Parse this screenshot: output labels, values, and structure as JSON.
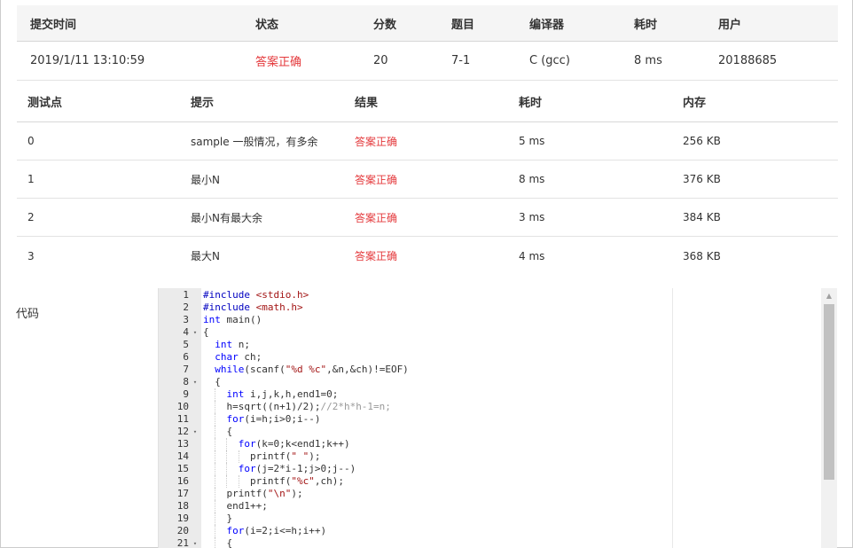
{
  "submission": {
    "headers": [
      "提交时间",
      "状态",
      "分数",
      "题目",
      "编译器",
      "耗时",
      "用户"
    ],
    "row": [
      "2019/1/11 13:10:59",
      "答案正确",
      "20",
      "7-1",
      "C (gcc)",
      "8 ms",
      "20188685"
    ]
  },
  "cases": {
    "headers": [
      "测试点",
      "提示",
      "结果",
      "耗时",
      "内存"
    ],
    "rows": [
      [
        "0",
        "sample 一般情况，有多余",
        "答案正确",
        "5 ms",
        "256 KB"
      ],
      [
        "1",
        "最小N",
        "答案正确",
        "8 ms",
        "376 KB"
      ],
      [
        "2",
        "最小N有最大余",
        "答案正确",
        "3 ms",
        "384 KB"
      ],
      [
        "3",
        "最大N",
        "答案正确",
        "4 ms",
        "368 KB"
      ]
    ]
  },
  "code_label": "代码",
  "code_lines": [
    {
      "n": "1",
      "fold": "",
      "text": "#include <stdio.h>"
    },
    {
      "n": "2",
      "fold": "",
      "text": "#include <math.h>"
    },
    {
      "n": "3",
      "fold": "",
      "text": "int main()"
    },
    {
      "n": "4",
      "fold": "▾",
      "text": "{"
    },
    {
      "n": "5",
      "fold": "",
      "text": "  int n;"
    },
    {
      "n": "6",
      "fold": "",
      "text": "  char ch;"
    },
    {
      "n": "7",
      "fold": "",
      "text": "  while(scanf(\"%d %c\",&n,&ch)!=EOF)"
    },
    {
      "n": "8",
      "fold": "▾",
      "text": "  {"
    },
    {
      "n": "9",
      "fold": "",
      "text": "    int i,j,k,h,end1=0;"
    },
    {
      "n": "10",
      "fold": "",
      "text": "    h=sqrt((n+1)/2);//2*h*h-1=n;"
    },
    {
      "n": "11",
      "fold": "",
      "text": "    for(i=h;i>0;i--)"
    },
    {
      "n": "12",
      "fold": "▾",
      "text": "    {"
    },
    {
      "n": "13",
      "fold": "",
      "text": "      for(k=0;k<end1;k++)"
    },
    {
      "n": "14",
      "fold": "",
      "text": "        printf(\" \");"
    },
    {
      "n": "15",
      "fold": "",
      "text": "      for(j=2*i-1;j>0;j--)"
    },
    {
      "n": "16",
      "fold": "",
      "text": "        printf(\"%c\",ch);"
    },
    {
      "n": "17",
      "fold": "",
      "text": "    printf(\"\\n\");"
    },
    {
      "n": "18",
      "fold": "",
      "text": "    end1++;"
    },
    {
      "n": "19",
      "fold": "",
      "text": "    }"
    },
    {
      "n": "20",
      "fold": "",
      "text": "    for(i=2;i<=h;i++)"
    },
    {
      "n": "21",
      "fold": "▾",
      "text": "    {"
    }
  ],
  "icons": {
    "fold": "chevron-down-icon",
    "scroll_up": "arrow-up-icon"
  },
  "colors": {
    "accepted": "#e4393c",
    "keyword": "#0000ff",
    "string": "#a31515",
    "comment": "#999999"
  }
}
